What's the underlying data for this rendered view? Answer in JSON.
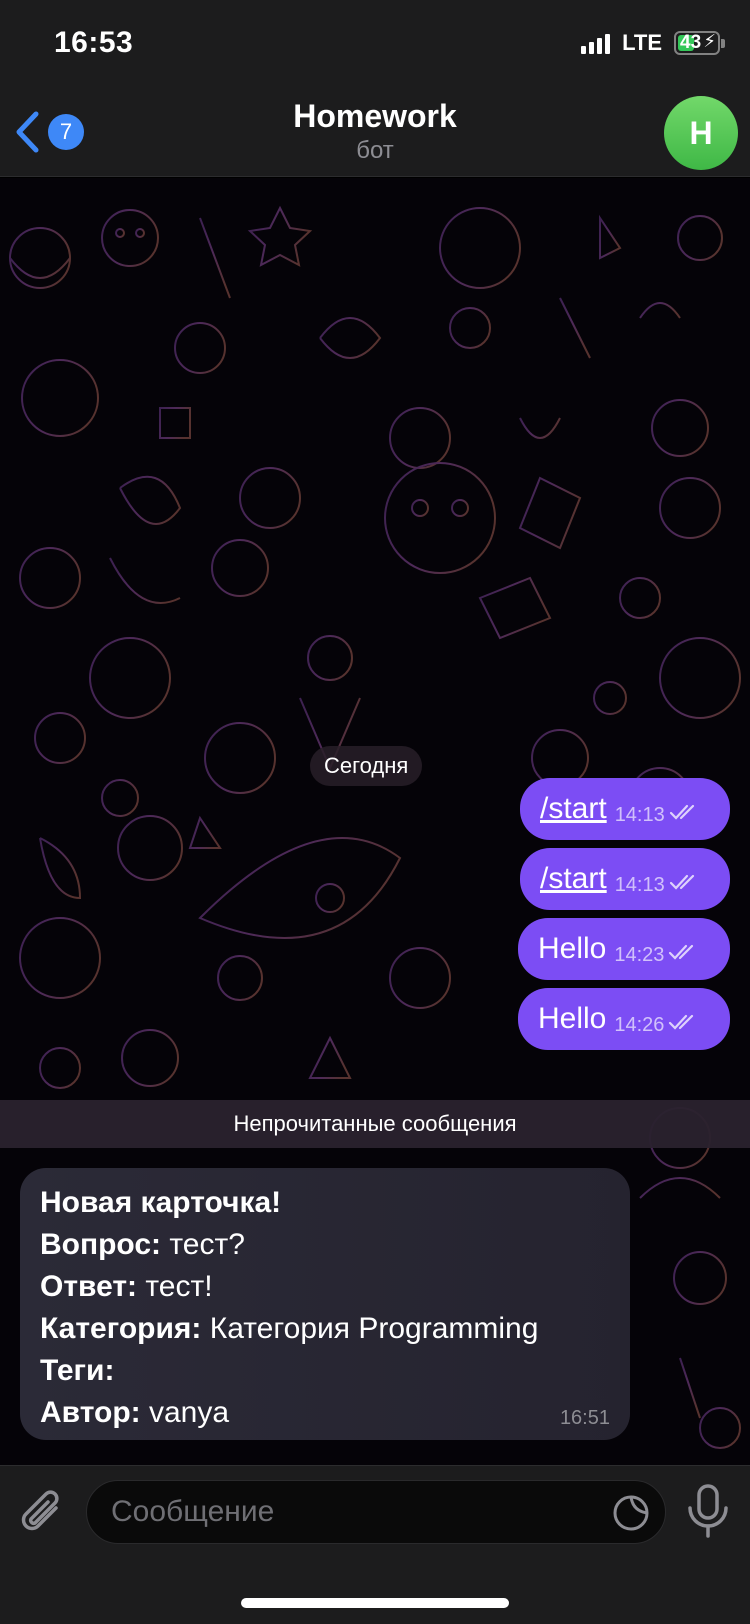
{
  "status_bar": {
    "time": "16:53",
    "network": "LTE",
    "battery_percent": "43",
    "battery_level": 0.43
  },
  "header": {
    "back_badge": "7",
    "title": "Homework",
    "subtitle": "бот",
    "avatar_initial": "H",
    "avatar_color": "#5cc95a"
  },
  "chat": {
    "date_label": "Сегодня",
    "outgoing": [
      {
        "text": "/start",
        "time": "14:13",
        "is_command": true
      },
      {
        "text": "/start",
        "time": "14:13",
        "is_command": true
      },
      {
        "text": "Hello",
        "time": "14:23",
        "is_command": false
      },
      {
        "text": "Hello",
        "time": "14:26",
        "is_command": false
      }
    ],
    "unread_label": "Непрочитанные сообщения",
    "incoming": {
      "title": "Новая карточка!",
      "question_label": "Вопрос:",
      "question_value": "тест?",
      "answer_label": "Ответ:",
      "answer_value": "тест!",
      "category_label": "Категория:",
      "category_value": "Категория Programming",
      "tags_label": "Теги:",
      "tags_value": "",
      "author_label": "Автор:",
      "author_value": "vanya",
      "time": "16:51"
    }
  },
  "input": {
    "placeholder": "Сообщение"
  },
  "colors": {
    "accent": "#3e88f7",
    "outgoing_bubble": "#7c4df4",
    "incoming_bubble": "#2b2a37"
  }
}
